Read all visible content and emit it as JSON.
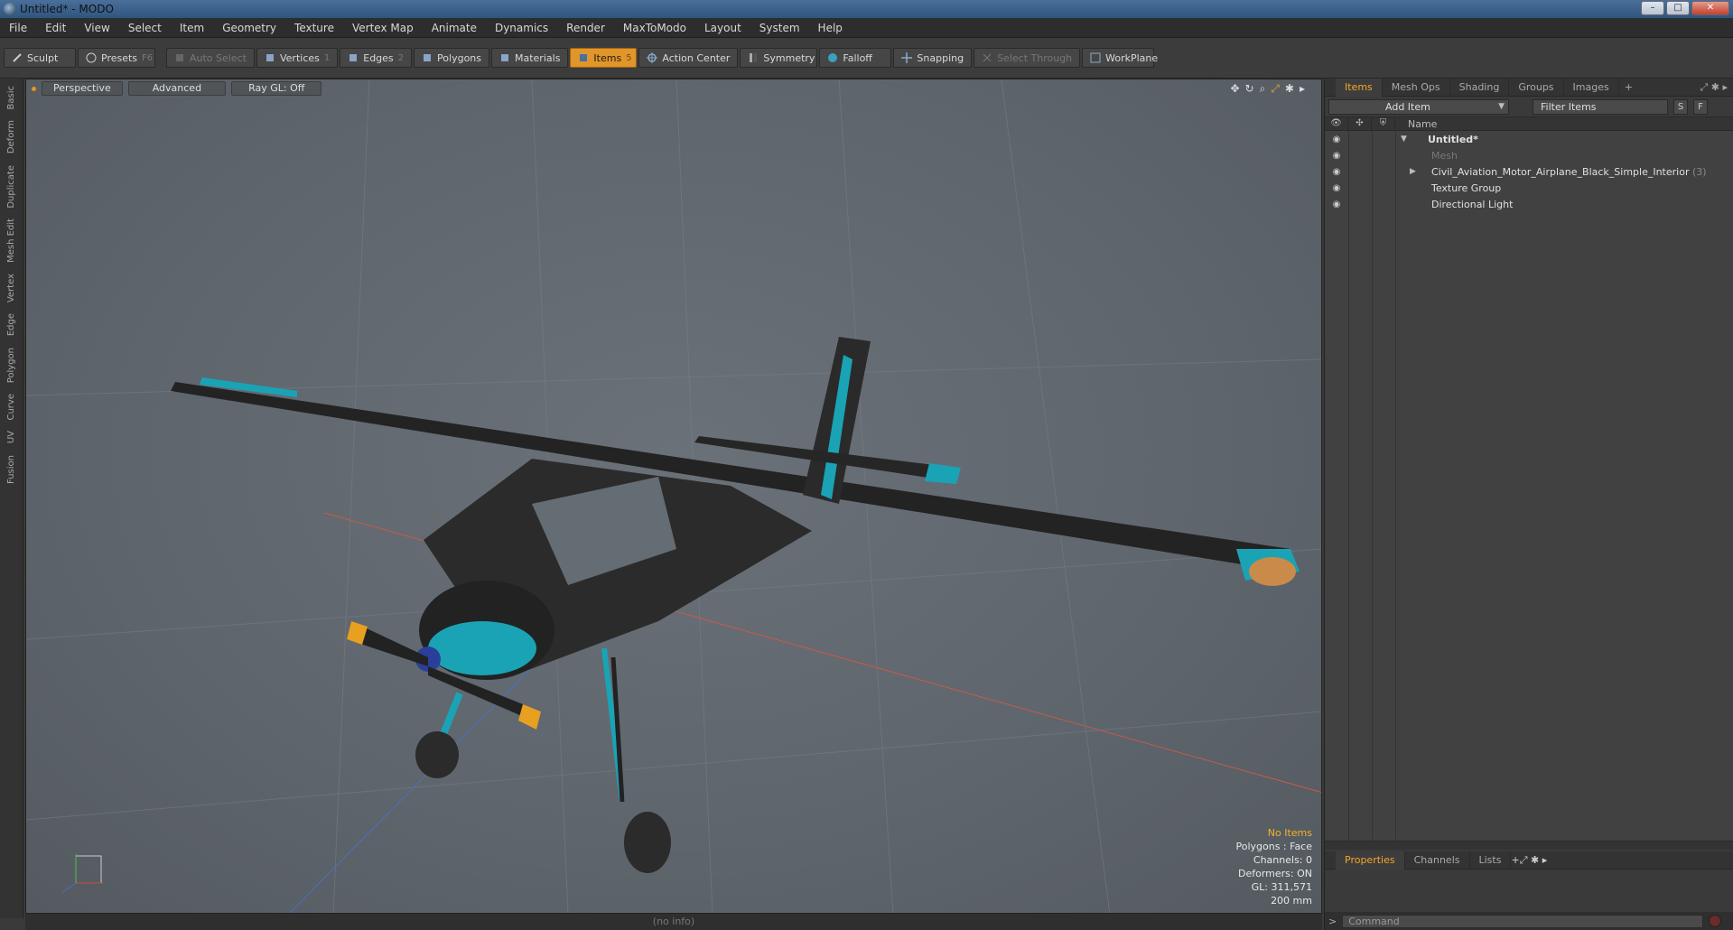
{
  "window": {
    "title": "Untitled* - MODO",
    "minimize": "–",
    "maximize": "□",
    "close": "✕"
  },
  "menu": [
    "File",
    "Edit",
    "View",
    "Select",
    "Item",
    "Geometry",
    "Texture",
    "Vertex Map",
    "Animate",
    "Dynamics",
    "Render",
    "MaxToModo",
    "Layout",
    "System",
    "Help"
  ],
  "toolbar": {
    "sculpt": "Sculpt",
    "presets": "Presets",
    "presets_key": "F6",
    "auto_select": "Auto Select",
    "vertices": "Vertices",
    "vertices_key": "1",
    "edges": "Edges",
    "edges_key": "2",
    "polygons": "Polygons",
    "materials": "Materials",
    "items": "Items",
    "items_key": "5",
    "action_center": "Action Center",
    "symmetry": "Symmetry",
    "falloff": "Falloff",
    "snapping": "Snapping",
    "select_through": "Select Through",
    "workplane": "WorkPlane"
  },
  "left_tabs": [
    "Basic",
    "Deform",
    "Duplicate",
    "Mesh Edit",
    "Vertex",
    "Edge",
    "Polygon",
    "Curve",
    "UV",
    "Fusion"
  ],
  "viewport": {
    "view": "Perspective",
    "shading": "Advanced",
    "raygl": "Ray GL: Off",
    "stats": {
      "selection": "No Items",
      "polygons": "Polygons : Face",
      "channels": "Channels: 0",
      "deformers": "Deformers: ON",
      "gl": "GL: 311,571",
      "scale": "200 mm"
    },
    "status": "(no info)"
  },
  "panel": {
    "tabs": [
      "Items",
      "Mesh Ops",
      "Shading",
      "Groups",
      "Images"
    ],
    "add_item": "Add Item",
    "filter_placeholder": "Filter Items",
    "s_btn": "S",
    "f_btn": "F",
    "name_col": "Name",
    "tree": [
      {
        "label": "Untitled*",
        "count": ""
      },
      {
        "label": "Mesh",
        "count": ""
      },
      {
        "label": "Civil_Aviation_Motor_Airplane_Black_Simple_Interior",
        "count": "(3)"
      },
      {
        "label": "Texture Group",
        "count": ""
      },
      {
        "label": "Directional Light",
        "count": ""
      }
    ],
    "bottom_tabs": [
      "Properties",
      "Channels",
      "Lists"
    ],
    "command_placeholder": "Command"
  },
  "colors": {
    "accent": "#e0962a",
    "teal": "#1aa3b5",
    "viewport_bg": "#5e656c"
  }
}
